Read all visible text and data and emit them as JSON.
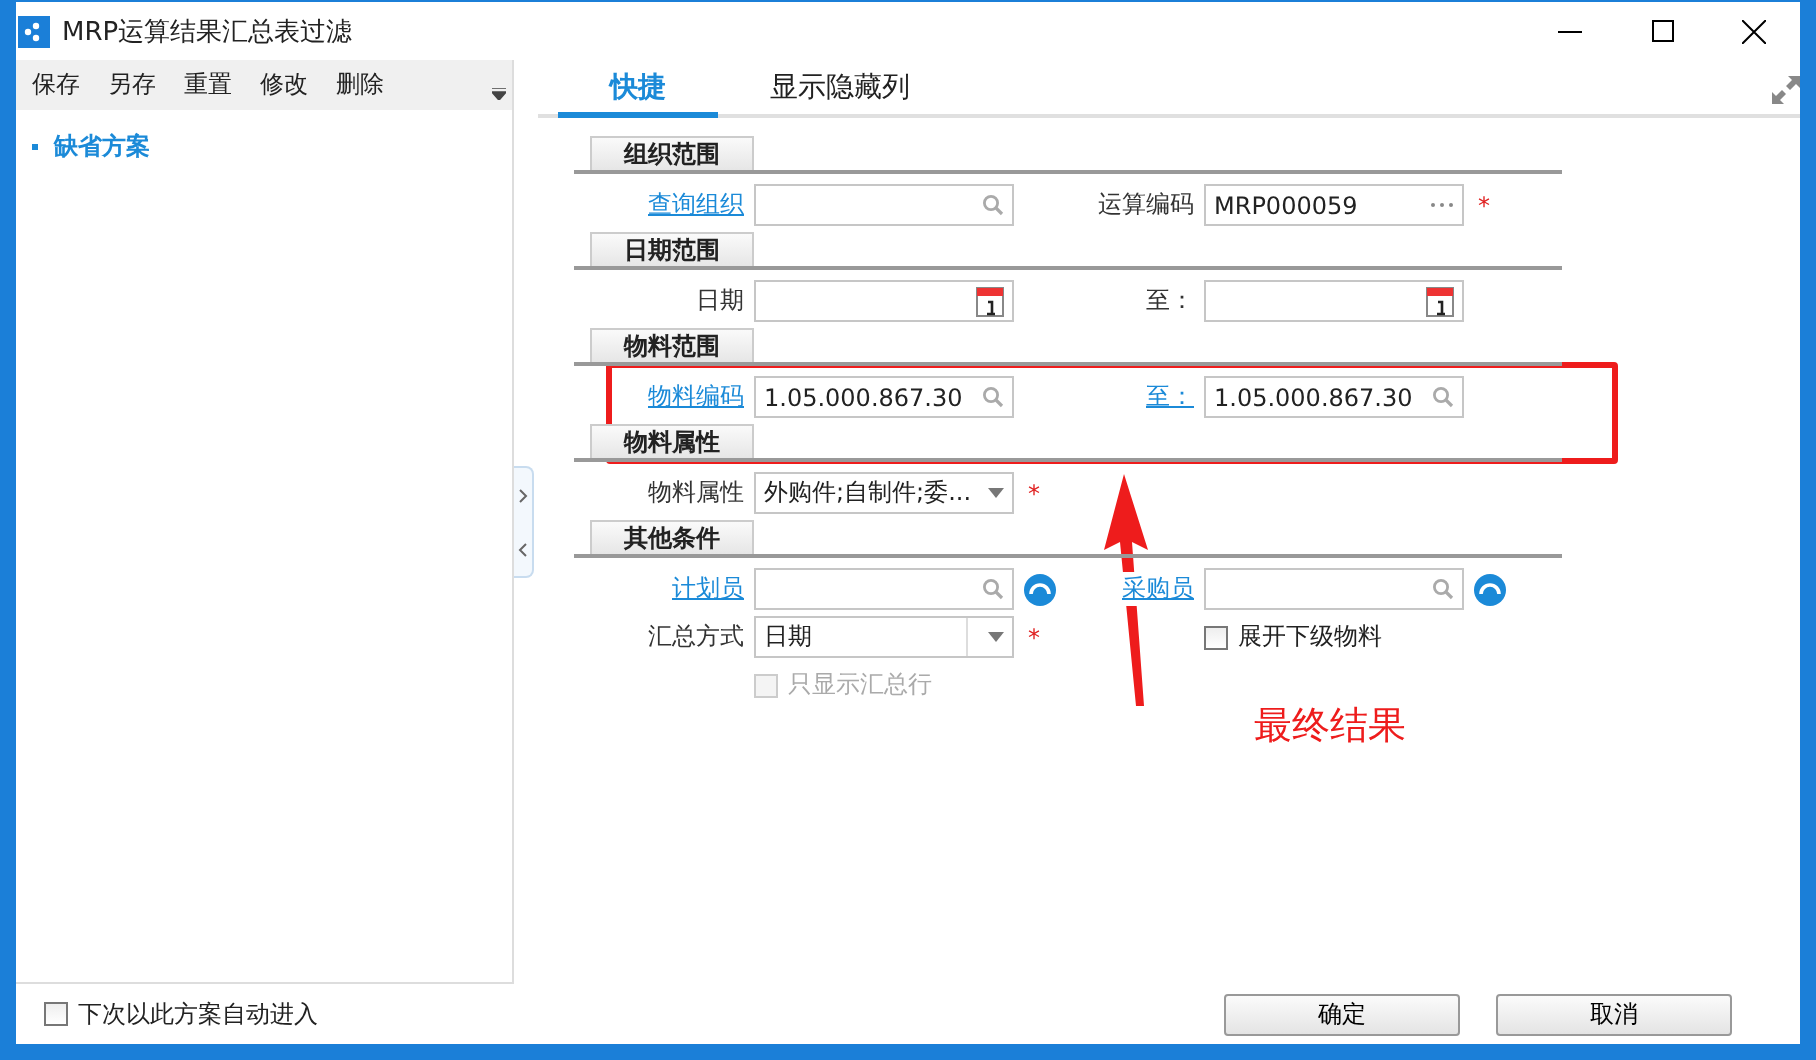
{
  "window": {
    "title": "MRP运算结果汇总表过滤"
  },
  "toolbar": [
    "保存",
    "另存",
    "重置",
    "修改",
    "删除"
  ],
  "schemes": [
    {
      "label": "缺省方案",
      "selected": true
    }
  ],
  "tabs": [
    {
      "label": "快捷",
      "selected": true
    },
    {
      "label": "显示隐藏列",
      "selected": false
    }
  ],
  "sections": [
    {
      "title": "组织范围",
      "rows": [
        {
          "left": {
            "kind": "lookup",
            "label": "查询组织",
            "link": true
          },
          "right": {
            "kind": "ellipsis",
            "label": "运算编码",
            "link": false,
            "value": "MRP000059",
            "required": true
          }
        }
      ]
    },
    {
      "title": "日期范围",
      "rows": [
        {
          "left": {
            "kind": "date",
            "label": "日期",
            "link": false
          },
          "right": {
            "kind": "date",
            "label": "至：",
            "link": false
          }
        }
      ]
    },
    {
      "title": "物料范围",
      "rows": [
        {
          "left": {
            "kind": "lookup",
            "label": "物料编码",
            "link": true,
            "value": "1.05.000.867.30"
          },
          "right": {
            "kind": "lookup",
            "label": "至：",
            "link": true,
            "value": "1.05.000.867.30"
          }
        }
      ]
    },
    {
      "title": "物料属性",
      "rows": [
        {
          "left": {
            "kind": "dropdown",
            "label": "物料属性",
            "link": false,
            "value": "外购件;自制件;委...",
            "required": true
          }
        }
      ]
    },
    {
      "title": "其他条件",
      "rows": [
        {
          "left": {
            "kind": "lookup",
            "label": "计划员",
            "link": true,
            "refresh": true
          },
          "right": {
            "kind": "lookup",
            "label": "采购员",
            "link": true,
            "refresh": true
          }
        },
        {
          "left": {
            "kind": "combo",
            "label": "汇总方式",
            "link": false,
            "value": "日期",
            "required": true
          },
          "right": {
            "kind": "checkbox",
            "label": "展开下级物料",
            "checked": false,
            "disabled": false
          }
        },
        {
          "left": {
            "kind": "checkbox",
            "label": "只显示汇总行",
            "checked": false,
            "disabled": true
          }
        }
      ]
    }
  ],
  "footer": {
    "auto_enter": {
      "label": "下次以此方案自动进入",
      "checked": false
    },
    "buttons": [
      "确定",
      "取消"
    ]
  },
  "required_mark": "*",
  "annotation": {
    "text": "最终结果"
  }
}
